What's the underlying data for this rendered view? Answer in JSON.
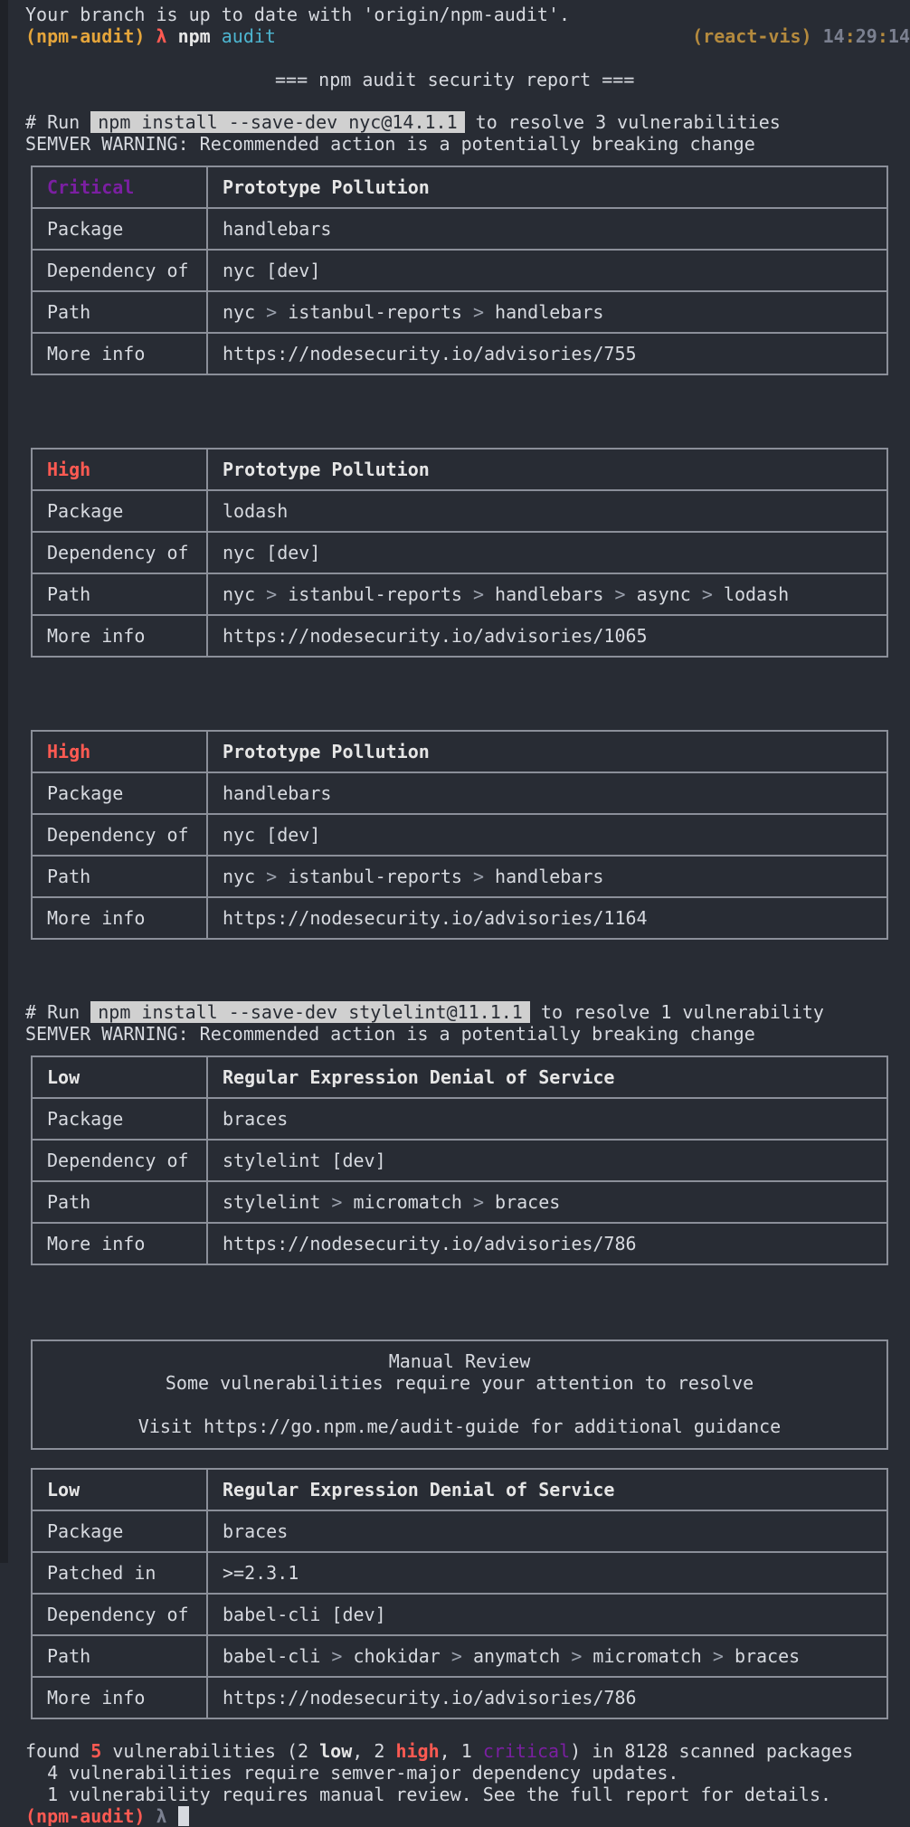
{
  "terminal": {
    "branch_status": "Your branch is up to date with 'origin/npm-audit'.",
    "prompt_dir": "(npm-audit)",
    "prompt_symbol": "λ",
    "command": "npm",
    "command_arg": "audit",
    "env": "(react-vis)",
    "clock_h": "14",
    "clock_m": "29",
    "clock_s": "14",
    "report_title": "=== npm audit security report ==="
  },
  "run_blocks": [
    {
      "prefix": "# Run ",
      "command": "npm install --save-dev nyc@14.1.1",
      "suffix": " to resolve 3 vulnerabilities",
      "warning": "SEMVER WARNING: Recommended action is a potentially breaking change"
    },
    {
      "prefix": "# Run ",
      "command": "npm install --save-dev stylelint@11.1.1",
      "suffix": " to resolve 1 vulnerability",
      "warning": "SEMVER WARNING: Recommended action is a potentially breaking change"
    }
  ],
  "advisories": [
    {
      "severity": "Critical",
      "severity_color": "#7b1fa2",
      "title": "Prototype Pollution",
      "rows": [
        {
          "key": "Package",
          "value": "handlebars"
        },
        {
          "key": "Dependency of",
          "value": "nyc [dev]"
        },
        {
          "key": "Path",
          "path": [
            "nyc",
            "istanbul-reports",
            "handlebars"
          ]
        },
        {
          "key": "More info",
          "value": "https://nodesecurity.io/advisories/755"
        }
      ]
    },
    {
      "severity": "High",
      "severity_color": "#ff5a52",
      "title": "Prototype Pollution",
      "rows": [
        {
          "key": "Package",
          "value": "lodash"
        },
        {
          "key": "Dependency of",
          "value": "nyc [dev]"
        },
        {
          "key": "Path",
          "path": [
            "nyc",
            "istanbul-reports",
            "handlebars",
            "async",
            "lodash"
          ]
        },
        {
          "key": "More info",
          "value": "https://nodesecurity.io/advisories/1065"
        }
      ]
    },
    {
      "severity": "High",
      "severity_color": "#ff5a52",
      "title": "Prototype Pollution",
      "rows": [
        {
          "key": "Package",
          "value": "handlebars"
        },
        {
          "key": "Dependency of",
          "value": "nyc [dev]"
        },
        {
          "key": "Path",
          "path": [
            "nyc",
            "istanbul-reports",
            "handlebars"
          ]
        },
        {
          "key": "More info",
          "value": "https://nodesecurity.io/advisories/1164"
        }
      ]
    },
    {
      "severity": "Low",
      "severity_color": "#e6e6e6",
      "title": "Regular Expression Denial of Service",
      "rows": [
        {
          "key": "Package",
          "value": "braces"
        },
        {
          "key": "Dependency of",
          "value": "stylelint [dev]"
        },
        {
          "key": "Path",
          "path": [
            "stylelint",
            "micromatch",
            "braces"
          ]
        },
        {
          "key": "More info",
          "value": "https://nodesecurity.io/advisories/786"
        }
      ]
    },
    {
      "severity": "Low",
      "severity_color": "#e6e6e6",
      "title": "Regular Expression Denial of Service",
      "rows": [
        {
          "key": "Package",
          "value": "braces"
        },
        {
          "key": "Patched in",
          "value": ">=2.3.1"
        },
        {
          "key": "Dependency of",
          "value": "babel-cli [dev]"
        },
        {
          "key": "Path",
          "path": [
            "babel-cli",
            "chokidar",
            "anymatch",
            "micromatch",
            "braces"
          ]
        },
        {
          "key": "More info",
          "value": "https://nodesecurity.io/advisories/786"
        }
      ]
    }
  ],
  "path_separator": " > ",
  "manual_review": {
    "title": "Manual Review",
    "subtitle": "Some vulnerabilities require your attention to resolve",
    "guide": "Visit https://go.npm.me/audit-guide for additional guidance"
  },
  "summary": {
    "found": "found ",
    "total": "5",
    "vulns_open": " vulnerabilities (",
    "low_count": "2 ",
    "low_word": "low",
    "comma1": ", ",
    "high_count": "2 ",
    "high_word": "high",
    "comma2": ", ",
    "critical_count": "1 ",
    "critical_word": "critical",
    "scanned": ") in 8128 scanned packages",
    "line2": "  4 vulnerabilities require semver-major dependency updates.",
    "line3": "  1 vulnerability requires manual review. See the full report for details."
  },
  "final_prompt": {
    "dir": "(npm-audit)",
    "symbol": "λ"
  }
}
